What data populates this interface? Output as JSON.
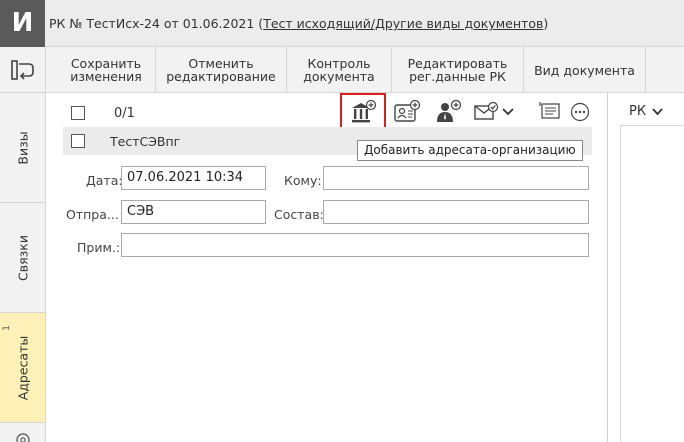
{
  "app": {
    "logo_letter": "И",
    "title_prefix": "РК № ТестИсх-24 от 01.06.2021 (",
    "title_link": "Тест исходящий/Другие виды документов",
    "title_suffix": ")"
  },
  "toolbar": {
    "save": "Сохранить\nизменения",
    "cancel": "Отменить\nредактирование",
    "control": "Контроль\nдокумента",
    "edit_reg": "Редактировать\nрег.данные РК",
    "doc_type": "Вид документа"
  },
  "sidebar": {
    "tabs": [
      {
        "label": "Визы"
      },
      {
        "label": "Связки"
      },
      {
        "label": "Адресаты",
        "count": "1"
      }
    ]
  },
  "list": {
    "counter": "0/1",
    "items": [
      {
        "name": "ТестСЭВпг"
      }
    ]
  },
  "tooltip": "Добавить адресата-организацию",
  "form": {
    "date_label": "Дата:",
    "date_value": "07.06.2021 10:34",
    "to_label": "Кому:",
    "to_value": "",
    "sender_label": "Отпра...",
    "sender_value": "СЭВ",
    "composition_label": "Состав:",
    "composition_value": "",
    "note_label": "Прим.:",
    "note_value": ""
  },
  "right_panel": {
    "label": "РК"
  },
  "icons": {
    "add_org": "add-organization-icon",
    "add_contact": "add-contact-card-icon",
    "add_person": "add-person-icon",
    "email": "email-check-icon",
    "chevron": "chevron-down-icon",
    "comment": "comment-icon",
    "more": "more-icon"
  },
  "colors": {
    "logo_bg": "#5a5a5a",
    "active_tab": "#fdf1b8",
    "highlight": "#d81e1e"
  }
}
